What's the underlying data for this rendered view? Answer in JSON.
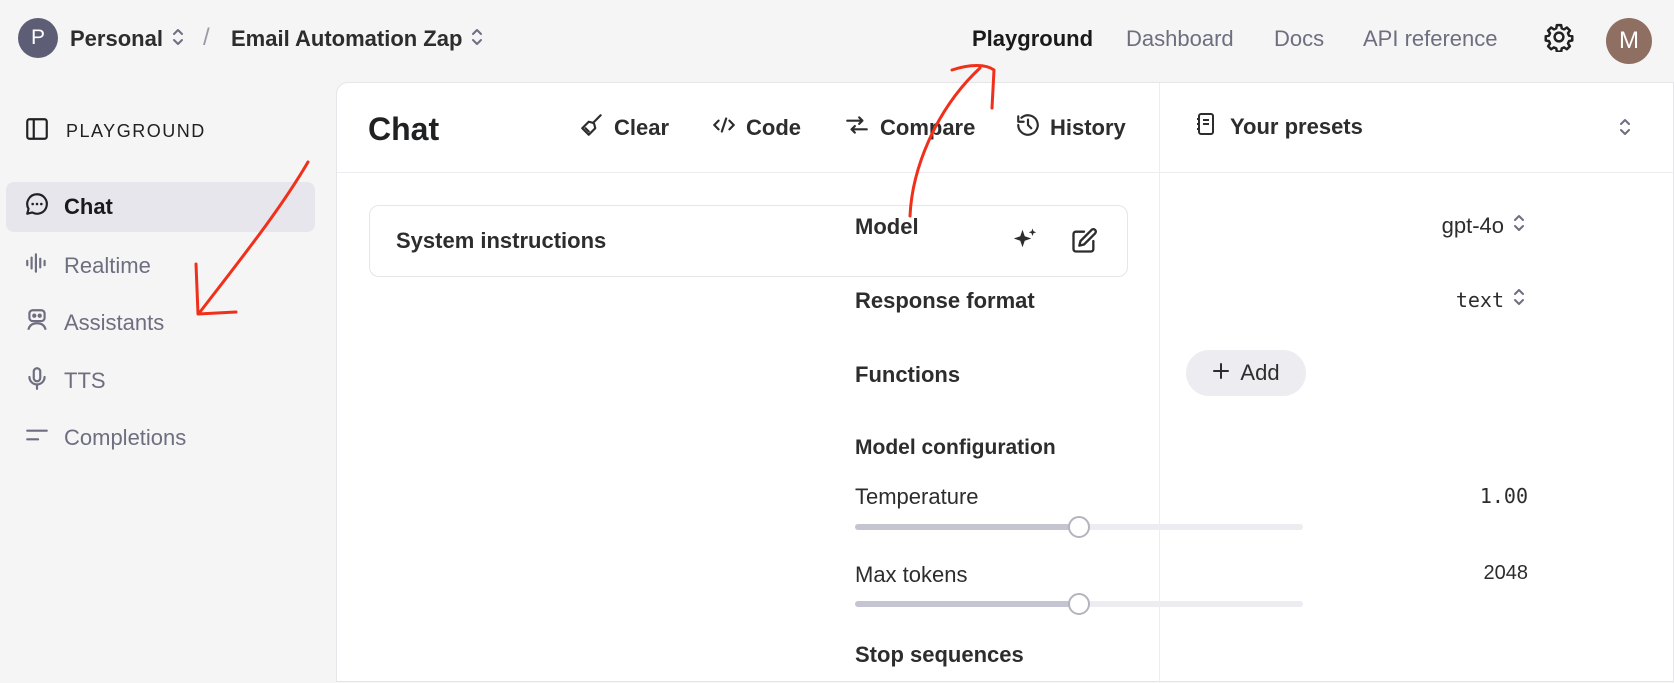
{
  "topbar": {
    "org_initial": "P",
    "org_name": "Personal",
    "separator": "/",
    "project_name": "Email Automation Zap",
    "nav": [
      "Playground",
      "Dashboard",
      "Docs",
      "API reference"
    ],
    "active_nav": "Playground",
    "user_initial": "M"
  },
  "sidebar": {
    "title": "PLAYGROUND",
    "items": [
      {
        "label": "Chat",
        "icon": "chat-bubble-icon",
        "active": true
      },
      {
        "label": "Realtime",
        "icon": "waveform-icon",
        "active": false
      },
      {
        "label": "Assistants",
        "icon": "robot-icon",
        "active": false
      },
      {
        "label": "TTS",
        "icon": "microphone-icon",
        "active": false
      },
      {
        "label": "Completions",
        "icon": "lines-icon",
        "active": false
      }
    ]
  },
  "chat": {
    "title": "Chat",
    "toolbar": {
      "clear": "Clear",
      "code": "Code",
      "compare": "Compare",
      "history": "History"
    },
    "system_instructions": "System instructions"
  },
  "settings": {
    "presets_label": "Your presets",
    "model_label": "Model",
    "model_value": "gpt-4o",
    "response_format_label": "Response format",
    "response_format_value": "text",
    "functions_label": "Functions",
    "add_label": "Add",
    "model_config_title": "Model configuration",
    "temperature_label": "Temperature",
    "temperature_value": "1.00",
    "temperature_fraction": 0.5,
    "max_tokens_label": "Max tokens",
    "max_tokens_value": "2048",
    "max_tokens_fraction": 0.5,
    "stop_sequences_label": "Stop sequences"
  },
  "colors": {
    "annotation": "#f0301a",
    "active_bg": "#e6e6ec",
    "muted_text": "#6e6e80"
  }
}
